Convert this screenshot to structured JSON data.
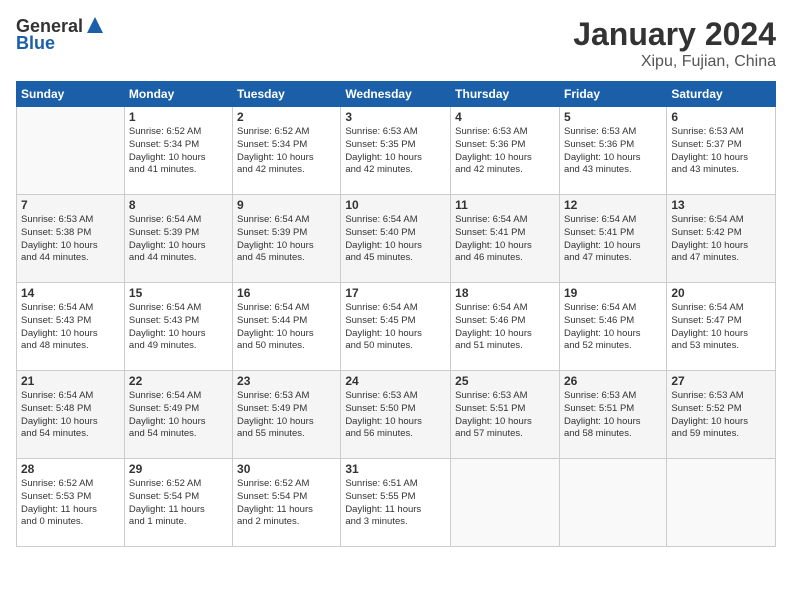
{
  "logo": {
    "line1": "General",
    "line2": "Blue"
  },
  "title": "January 2024",
  "subtitle": "Xipu, Fujian, China",
  "header_days": [
    "Sunday",
    "Monday",
    "Tuesday",
    "Wednesday",
    "Thursday",
    "Friday",
    "Saturday"
  ],
  "weeks": [
    [
      {
        "day": "",
        "info": ""
      },
      {
        "day": "1",
        "info": "Sunrise: 6:52 AM\nSunset: 5:34 PM\nDaylight: 10 hours\nand 41 minutes."
      },
      {
        "day": "2",
        "info": "Sunrise: 6:52 AM\nSunset: 5:34 PM\nDaylight: 10 hours\nand 42 minutes."
      },
      {
        "day": "3",
        "info": "Sunrise: 6:53 AM\nSunset: 5:35 PM\nDaylight: 10 hours\nand 42 minutes."
      },
      {
        "day": "4",
        "info": "Sunrise: 6:53 AM\nSunset: 5:36 PM\nDaylight: 10 hours\nand 42 minutes."
      },
      {
        "day": "5",
        "info": "Sunrise: 6:53 AM\nSunset: 5:36 PM\nDaylight: 10 hours\nand 43 minutes."
      },
      {
        "day": "6",
        "info": "Sunrise: 6:53 AM\nSunset: 5:37 PM\nDaylight: 10 hours\nand 43 minutes."
      }
    ],
    [
      {
        "day": "7",
        "info": "Sunrise: 6:53 AM\nSunset: 5:38 PM\nDaylight: 10 hours\nand 44 minutes."
      },
      {
        "day": "8",
        "info": "Sunrise: 6:54 AM\nSunset: 5:39 PM\nDaylight: 10 hours\nand 44 minutes."
      },
      {
        "day": "9",
        "info": "Sunrise: 6:54 AM\nSunset: 5:39 PM\nDaylight: 10 hours\nand 45 minutes."
      },
      {
        "day": "10",
        "info": "Sunrise: 6:54 AM\nSunset: 5:40 PM\nDaylight: 10 hours\nand 45 minutes."
      },
      {
        "day": "11",
        "info": "Sunrise: 6:54 AM\nSunset: 5:41 PM\nDaylight: 10 hours\nand 46 minutes."
      },
      {
        "day": "12",
        "info": "Sunrise: 6:54 AM\nSunset: 5:41 PM\nDaylight: 10 hours\nand 47 minutes."
      },
      {
        "day": "13",
        "info": "Sunrise: 6:54 AM\nSunset: 5:42 PM\nDaylight: 10 hours\nand 47 minutes."
      }
    ],
    [
      {
        "day": "14",
        "info": "Sunrise: 6:54 AM\nSunset: 5:43 PM\nDaylight: 10 hours\nand 48 minutes."
      },
      {
        "day": "15",
        "info": "Sunrise: 6:54 AM\nSunset: 5:43 PM\nDaylight: 10 hours\nand 49 minutes."
      },
      {
        "day": "16",
        "info": "Sunrise: 6:54 AM\nSunset: 5:44 PM\nDaylight: 10 hours\nand 50 minutes."
      },
      {
        "day": "17",
        "info": "Sunrise: 6:54 AM\nSunset: 5:45 PM\nDaylight: 10 hours\nand 50 minutes."
      },
      {
        "day": "18",
        "info": "Sunrise: 6:54 AM\nSunset: 5:46 PM\nDaylight: 10 hours\nand 51 minutes."
      },
      {
        "day": "19",
        "info": "Sunrise: 6:54 AM\nSunset: 5:46 PM\nDaylight: 10 hours\nand 52 minutes."
      },
      {
        "day": "20",
        "info": "Sunrise: 6:54 AM\nSunset: 5:47 PM\nDaylight: 10 hours\nand 53 minutes."
      }
    ],
    [
      {
        "day": "21",
        "info": "Sunrise: 6:54 AM\nSunset: 5:48 PM\nDaylight: 10 hours\nand 54 minutes."
      },
      {
        "day": "22",
        "info": "Sunrise: 6:54 AM\nSunset: 5:49 PM\nDaylight: 10 hours\nand 54 minutes."
      },
      {
        "day": "23",
        "info": "Sunrise: 6:53 AM\nSunset: 5:49 PM\nDaylight: 10 hours\nand 55 minutes."
      },
      {
        "day": "24",
        "info": "Sunrise: 6:53 AM\nSunset: 5:50 PM\nDaylight: 10 hours\nand 56 minutes."
      },
      {
        "day": "25",
        "info": "Sunrise: 6:53 AM\nSunset: 5:51 PM\nDaylight: 10 hours\nand 57 minutes."
      },
      {
        "day": "26",
        "info": "Sunrise: 6:53 AM\nSunset: 5:51 PM\nDaylight: 10 hours\nand 58 minutes."
      },
      {
        "day": "27",
        "info": "Sunrise: 6:53 AM\nSunset: 5:52 PM\nDaylight: 10 hours\nand 59 minutes."
      }
    ],
    [
      {
        "day": "28",
        "info": "Sunrise: 6:52 AM\nSunset: 5:53 PM\nDaylight: 11 hours\nand 0 minutes."
      },
      {
        "day": "29",
        "info": "Sunrise: 6:52 AM\nSunset: 5:54 PM\nDaylight: 11 hours\nand 1 minute."
      },
      {
        "day": "30",
        "info": "Sunrise: 6:52 AM\nSunset: 5:54 PM\nDaylight: 11 hours\nand 2 minutes."
      },
      {
        "day": "31",
        "info": "Sunrise: 6:51 AM\nSunset: 5:55 PM\nDaylight: 11 hours\nand 3 minutes."
      },
      {
        "day": "",
        "info": ""
      },
      {
        "day": "",
        "info": ""
      },
      {
        "day": "",
        "info": ""
      }
    ]
  ]
}
